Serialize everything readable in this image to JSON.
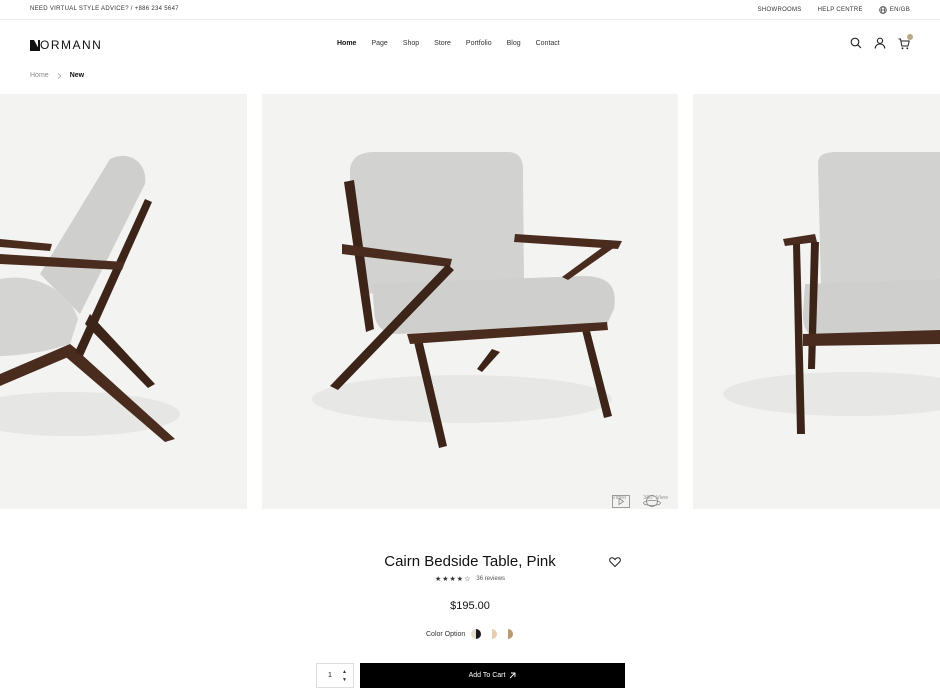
{
  "topbar": {
    "advice": "NEED VIRTUAL STYLE ADVICE? / +886 234 5647",
    "showrooms": "SHOWROOMS",
    "help": "HELP CENTRE",
    "lang": "EN/GB"
  },
  "header": {
    "logo": "ORMANN",
    "nav": [
      "Home",
      "Page",
      "Shop",
      "Store",
      "Portfolio",
      "Blog",
      "Contact"
    ]
  },
  "breadcrumb": {
    "home": "Home",
    "current": "New"
  },
  "gallery": {
    "video_label": "Video",
    "view360_label": "360° View"
  },
  "product": {
    "title": "Cairn Bedside Table, Pink",
    "rating": 4,
    "reviews": "36 reviews",
    "price": "$195.00",
    "color_label": "Color Option",
    "swatches": [
      "#1b1b1b",
      "#e6cfae",
      "#b89a6e"
    ],
    "quantity": "1",
    "add_to_cart": "Add To Cart"
  }
}
